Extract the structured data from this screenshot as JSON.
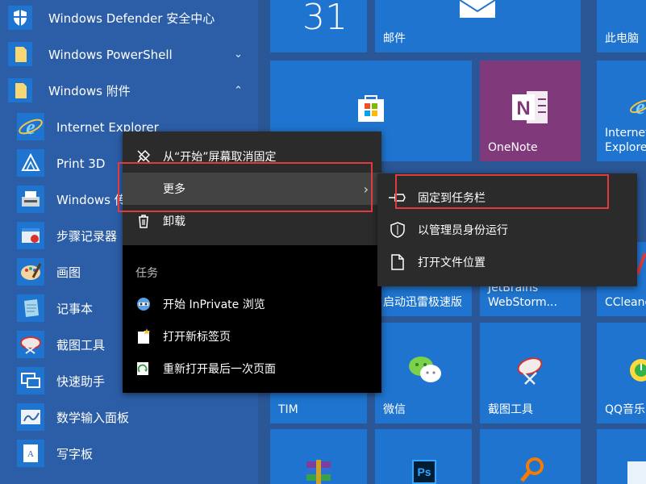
{
  "apps": [
    {
      "label": "Windows Defender 安全中心",
      "icon": "shield-icon"
    },
    {
      "label": "Windows PowerShell",
      "icon": "folder-icon",
      "chevron": "⌄"
    },
    {
      "label": "Windows 附件",
      "icon": "folder-icon",
      "chevron": "⌃"
    },
    {
      "label": "Internet Explorer",
      "icon": "internet-explorer-icon"
    },
    {
      "label": "Print 3D",
      "icon": "print3d-icon"
    },
    {
      "label": "Windows 传",
      "icon": "windows-fax-icon"
    },
    {
      "label": "步骤记录器",
      "icon": "steps-recorder-icon"
    },
    {
      "label": "画图",
      "icon": "paint-icon"
    },
    {
      "label": "记事本",
      "icon": "notepad-icon"
    },
    {
      "label": "截图工具",
      "icon": "snipping-tool-icon"
    },
    {
      "label": "快速助手",
      "icon": "quick-assist-icon"
    },
    {
      "label": "数学输入面板",
      "icon": "math-input-icon"
    },
    {
      "label": "写字板",
      "icon": "wordpad-icon"
    }
  ],
  "tiles": {
    "calendar_day": "31",
    "mail": "邮件",
    "this_pc": "此电脑",
    "onenote": "OneNote",
    "ie_line1": "Internet",
    "ie_line2": "Explorer",
    "thunder": "启动迅雷极速版",
    "webstorm_line1": "JetBrains",
    "webstorm_line2": "WebStorm...",
    "ccleaner": "CCleane",
    "tim": "TIM",
    "wechat": "微信",
    "snipping": "截图工具",
    "qqmusic": "QQ音乐",
    "ps_text": "Ps"
  },
  "context_menu": {
    "unpin": "从“开始”屏幕取消固定",
    "more": "更多",
    "more_arrow": "›",
    "uninstall": "卸载",
    "tasks_header": "任务",
    "inprivate": "开始 InPrivate 浏览",
    "new_tab": "打开新标签页",
    "reopen": "重新打开最后一次页面"
  },
  "submenu": {
    "pin_taskbar": "固定到任务栏",
    "run_admin": "以管理员身份运行",
    "open_location": "打开文件位置"
  },
  "colors": {
    "highlight": "#e0393e",
    "tile": "#1e74cf",
    "onenote": "#80397b"
  }
}
